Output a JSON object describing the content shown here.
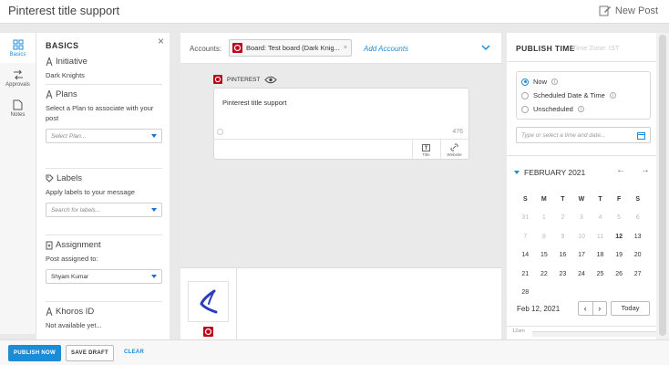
{
  "header": {
    "title": "Pinterest title support",
    "new_post": "New Post"
  },
  "rail": [
    {
      "label": "Basics"
    },
    {
      "label": "Approvals"
    },
    {
      "label": "Notes"
    }
  ],
  "basics": {
    "title": "BASICS",
    "initiative": {
      "heading": "Initiative",
      "value": "Dark Knights"
    },
    "plans": {
      "heading": "Plans",
      "text": "Select a Plan to associate with your post",
      "placeholder": "Select Plan..."
    },
    "labels": {
      "heading": "Labels",
      "text": "Apply labels to your message",
      "placeholder": "Search for labels..."
    },
    "assignment": {
      "heading": "Assignment",
      "text": "Post assigned to:",
      "value": "Shyam Kumar"
    },
    "khoros": {
      "heading": "Khoros ID",
      "text": "Not available yet..."
    }
  },
  "accounts": {
    "label": "Accounts:",
    "chip": "Board: Test board (Dark Knig...",
    "add": "Add Accounts"
  },
  "compose": {
    "network": "PINTEREST",
    "message": "Pinterest title support",
    "count": "476",
    "tools": [
      {
        "label": "Title"
      },
      {
        "label": "Website"
      }
    ]
  },
  "publish": {
    "title": "PUBLISH TIME",
    "timezone": "Time Zone: IST",
    "options": [
      {
        "label": "Now",
        "selected": true
      },
      {
        "label": "Scheduled Date & Time",
        "selected": false
      },
      {
        "label": "Unscheduled",
        "selected": false
      }
    ],
    "date_placeholder": "Type or select a time and date..."
  },
  "calendar": {
    "month": "FEBRUARY 2021",
    "weekdays": [
      "S",
      "M",
      "T",
      "W",
      "T",
      "F",
      "S"
    ],
    "weeks": [
      [
        {
          "d": "31",
          "dim": true
        },
        {
          "d": "1",
          "dim": true
        },
        {
          "d": "2",
          "dim": true
        },
        {
          "d": "3",
          "dim": true
        },
        {
          "d": "4",
          "dim": true
        },
        {
          "d": "5",
          "dim": true
        },
        {
          "d": "6",
          "dim": true
        }
      ],
      [
        {
          "d": "7",
          "dim": true
        },
        {
          "d": "8",
          "dim": true
        },
        {
          "d": "9",
          "dim": true
        },
        {
          "d": "10",
          "dim": true
        },
        {
          "d": "11",
          "dim": true
        },
        {
          "d": "12",
          "bold": true
        },
        {
          "d": "13"
        }
      ],
      [
        {
          "d": "14"
        },
        {
          "d": "15"
        },
        {
          "d": "16"
        },
        {
          "d": "17"
        },
        {
          "d": "18"
        },
        {
          "d": "19"
        },
        {
          "d": "20"
        }
      ],
      [
        {
          "d": "21"
        },
        {
          "d": "22"
        },
        {
          "d": "23"
        },
        {
          "d": "24"
        },
        {
          "d": "25"
        },
        {
          "d": "26"
        },
        {
          "d": "27"
        }
      ],
      [
        {
          "d": "28"
        }
      ]
    ],
    "selected_date": "Feb 12, 2021",
    "today_label": "Today",
    "hour_label": "12am"
  },
  "footer": {
    "publish": "PUBLISH NOW",
    "draft": "SAVE DRAFT",
    "clear": "CLEAR"
  },
  "colors": {
    "accent": "#1b8cd8",
    "pinterest": "#bd081c"
  }
}
